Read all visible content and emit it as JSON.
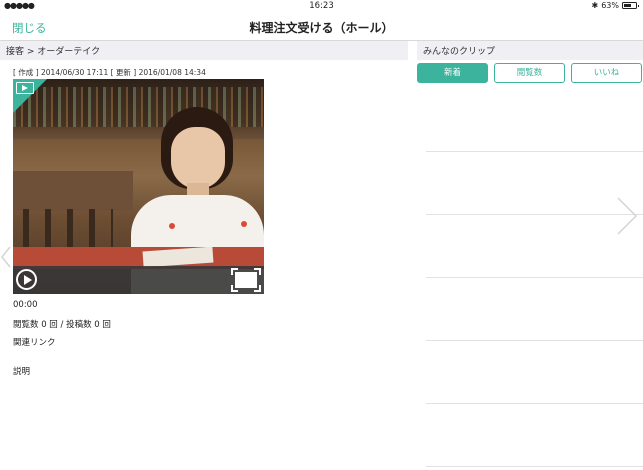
{
  "status_bar": {
    "signal": "●●●●●",
    "time": "16:23",
    "bluetooth": "✱",
    "battery_percent": "63%",
    "battery_level": 0.63
  },
  "nav": {
    "close_label": "閉じる",
    "title": "料理注文受ける（ホール）"
  },
  "breadcrumb": "接客 > オーダーテイク",
  "meta": "[ 作成 ] 2014/06/30 17:11  [ 更新 ] 2016/01/08 14:34",
  "video": {
    "time": "00:00"
  },
  "stats": "閲覧数 0 回 / 投稿数 0 回",
  "links_label": "関連リンク",
  "description_label": "説明",
  "clips": {
    "header": "みんなのクリップ",
    "tabs": [
      {
        "label": "新着",
        "active": true
      },
      {
        "label": "閲覧数",
        "active": false
      },
      {
        "label": "いいね",
        "active": false
      }
    ]
  },
  "colors": {
    "accent": "#3bb39d",
    "section_bg": "#efeff4"
  },
  "icons": {
    "next": "chevron-right-icon",
    "prev": "chevron-left-icon",
    "play": "play-icon",
    "fullscreen": "fullscreen-icon",
    "video_badge": "video-badge-icon"
  }
}
